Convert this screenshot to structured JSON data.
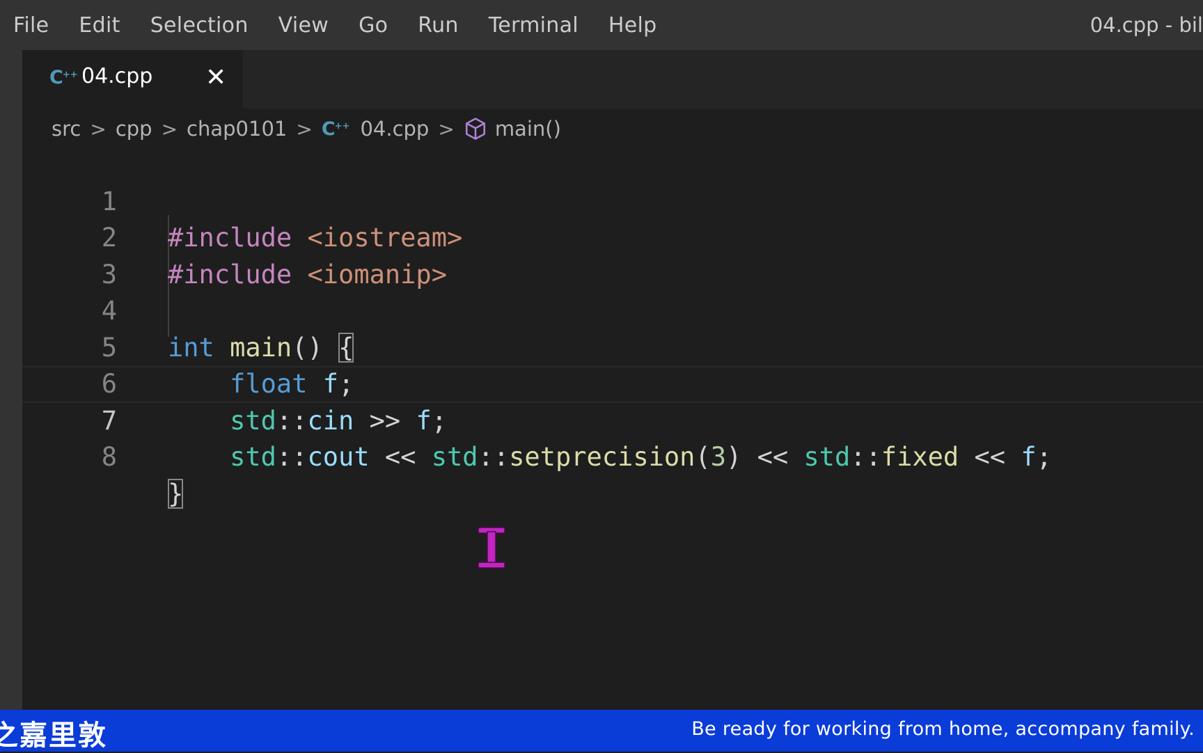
{
  "menubar": {
    "items": [
      "File",
      "Edit",
      "Selection",
      "View",
      "Go",
      "Run",
      "Terminal",
      "Help"
    ],
    "window_title": "04.cpp - bil"
  },
  "tab": {
    "label": "04.cpp",
    "close_glyph": "✕",
    "icon": "cpp-file-icon"
  },
  "breadcrumb": {
    "parts": [
      "src",
      "cpp",
      "chap0101",
      "04.cpp",
      "main()"
    ],
    "separator": ">"
  },
  "editor": {
    "line_numbers": [
      "1",
      "2",
      "3",
      "4",
      "5",
      "6",
      "7",
      "8"
    ],
    "active_line": 7,
    "lines": [
      "#include <iostream>",
      "#include <iomanip>",
      "",
      "int main() {",
      "    float f;",
      "    std::cin >> f;",
      "    std::cout << std::setprecision(3) << std::fixed << f;",
      "}"
    ]
  },
  "banner": {
    "left_text": "之嘉里敦",
    "right_text": "Be ready for working from home, accompany family."
  },
  "colors": {
    "menubar": "#333333",
    "editor_bg": "#1e1e1e",
    "banner": "#0a3cd8",
    "cursor": "#c026c0"
  }
}
